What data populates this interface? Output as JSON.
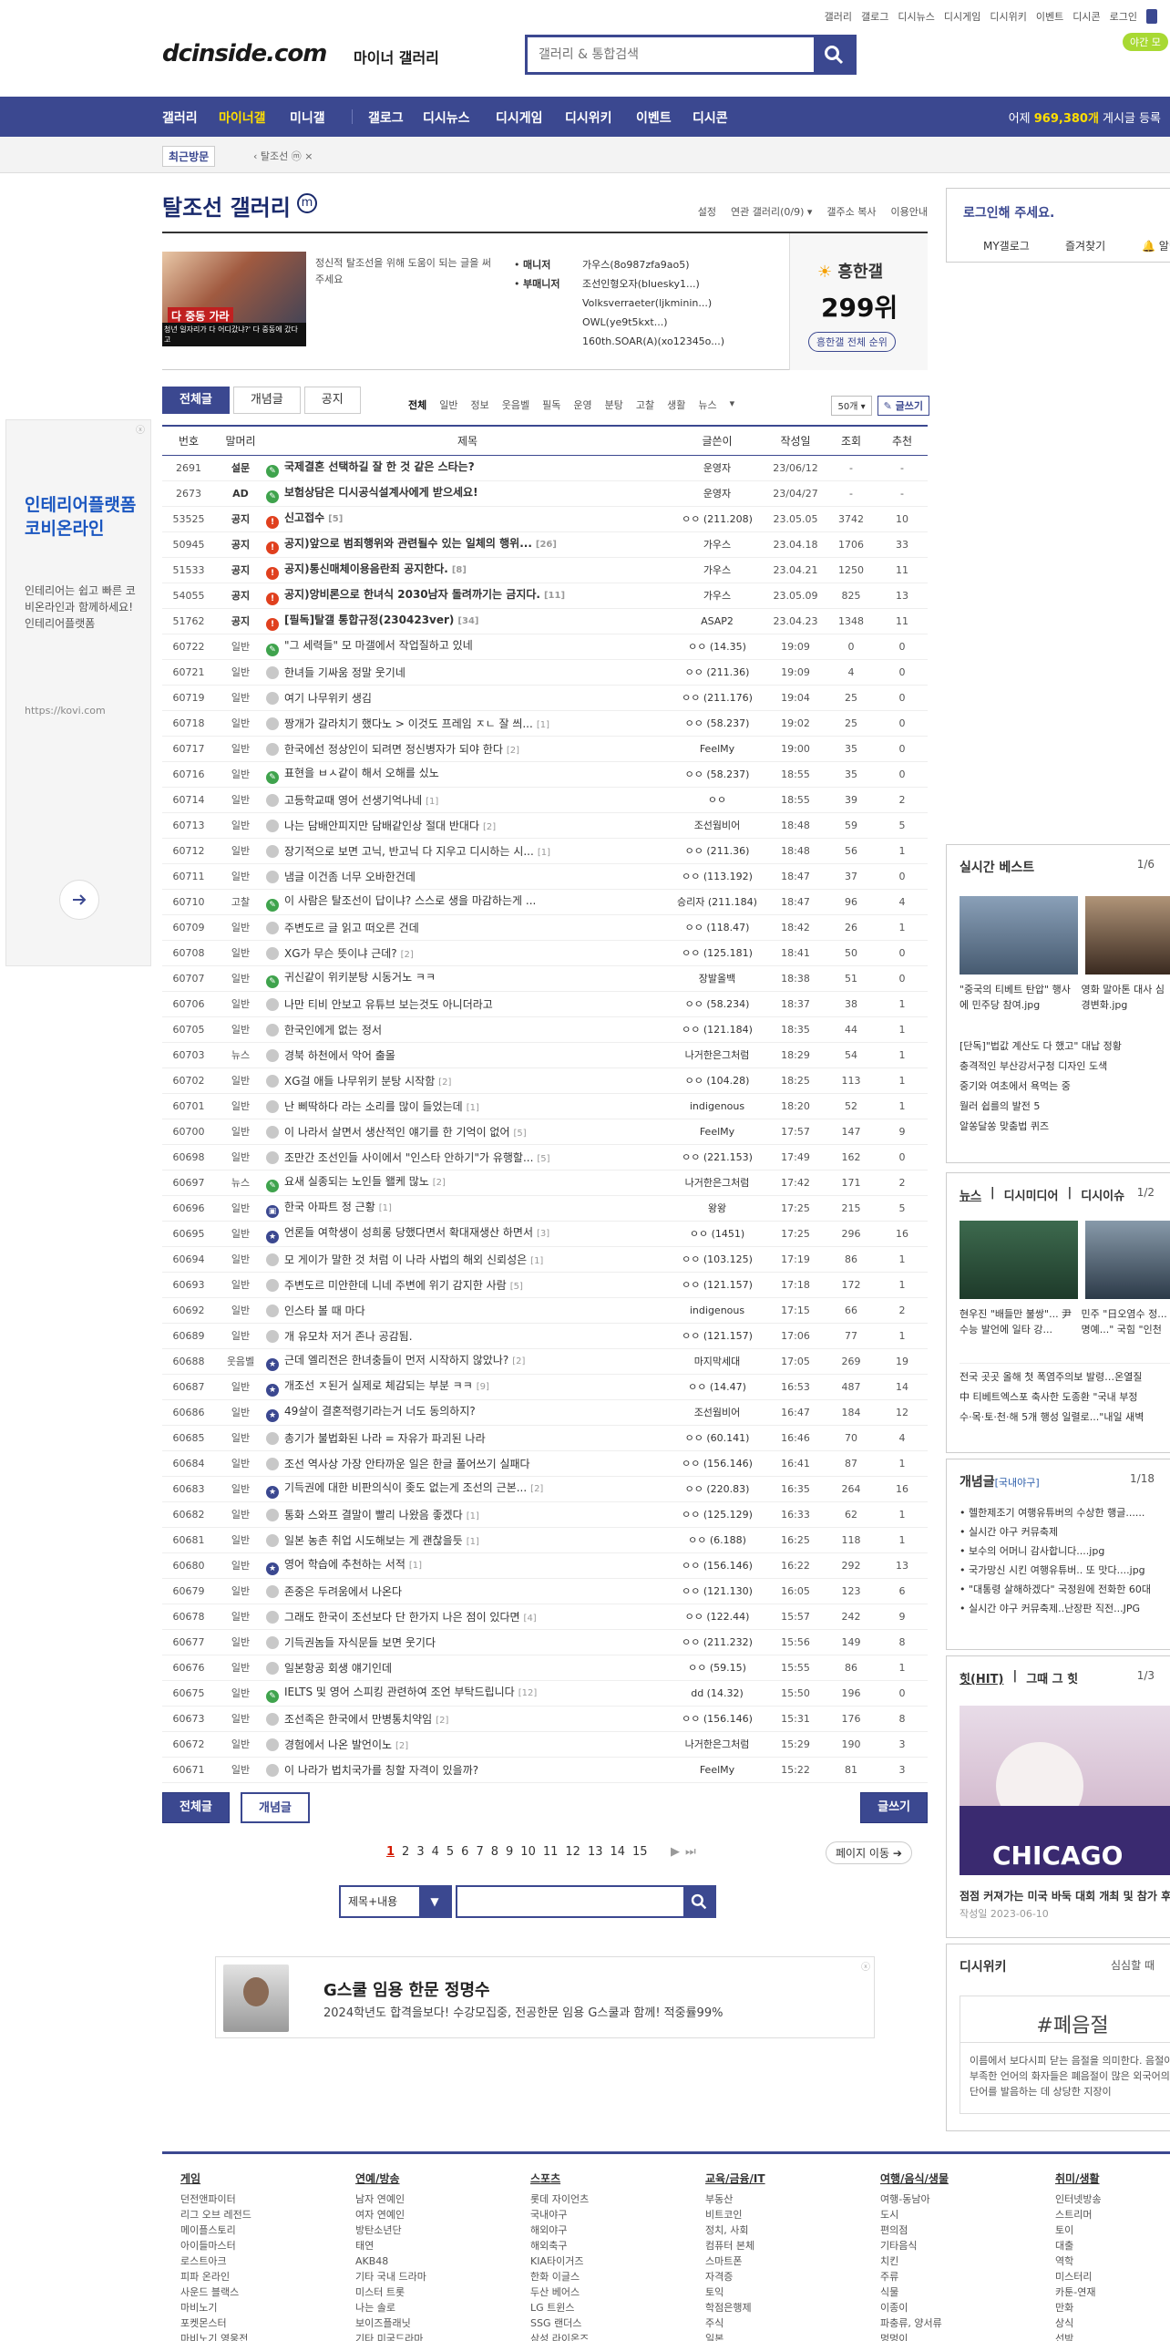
{
  "top_menu": [
    "갤러리",
    "미니갤",
    "갤로그",
    "디시뉴스",
    "디시게임",
    "디시위키",
    "이벤트",
    "디시콘",
    "로그인"
  ],
  "logo": "dcinside.com",
  "logo_sub": "마이너 갤러리",
  "search_placeholder": "갤러리 & 통합검색",
  "app_btn": "야간 모",
  "gnb": {
    "items": [
      "갤러리",
      "마이너갤",
      "미니갤",
      "갤로그",
      "디시뉴스",
      "디시게임",
      "디시위키",
      "이벤트",
      "디시콘"
    ],
    "visit_prefix": "어제 ",
    "visit_count": "969,380개",
    "visit_suffix": " 게시글 등록"
  },
  "subbar": {
    "recent": "최근방문",
    "crumb": "‹ 탈조선 ⓜ  ×"
  },
  "gallery": {
    "title": "탈조선 갤러리",
    "title_badge": "m",
    "links": [
      "설정",
      "연관 갤러리(0/9) ▾",
      "갤주소 복사",
      "이용안내"
    ],
    "desc": "정신적 탈조선을 위해 도움이 되는 글을 써주세요",
    "thumb_cap": "다 중동 가라",
    "thumb_cap2": "청년 일자리가 다 어디갔냐?' 다 중동에 갔다고",
    "manager_label": "매니저",
    "submanager_label": "부매니저",
    "manager": "가우스(8o987zfa9ao5)",
    "submanagers": [
      "조선인형오자(bluesky1...)",
      "Volksverraeter(ljkminin...)",
      "OWL(ye9t5kxt...)",
      "160th.SOAR(A)(xo12345o...)"
    ],
    "rank_title": "흥한갤",
    "rank": "299위",
    "rank_btn": "흥한갤 전체 순위"
  },
  "tabs": [
    "전체글",
    "개념글",
    "공지"
  ],
  "subtabs": [
    "전체",
    "일반",
    "정보",
    "웃음벨",
    "필독",
    "운영",
    "분탕",
    "고찰",
    "생활",
    "뉴스",
    "▾"
  ],
  "list_count": "50개 ▾",
  "write_btn": "✎ 글쓰기",
  "columns": [
    "번호",
    "말머리",
    "제목",
    "글쓴이",
    "작성일",
    "조회",
    "추천"
  ],
  "rows": [
    {
      "no": "2691",
      "head": "설문",
      "title": "국제결혼 선택하길 잘 한 것 같은 스타는?",
      "rep": "",
      "author": "운영자",
      "date": "23/06/12",
      "views": "-",
      "rec": "-",
      "ic": "g",
      "notice": true
    },
    {
      "no": "2673",
      "head": "AD",
      "title": "보험상담은 디시공식설계사에게 받으세요!",
      "rep": "",
      "author": "운영자",
      "date": "23/04/27",
      "views": "-",
      "rec": "-",
      "ic": "g",
      "notice": true
    },
    {
      "no": "53525",
      "head": "공지",
      "title": "신고접수",
      "rep": "[5]",
      "author": "ㅇㅇ (211.208)",
      "date": "23.05.05",
      "views": "3742",
      "rec": "10",
      "ic": "r",
      "notice": true
    },
    {
      "no": "50945",
      "head": "공지",
      "title": "공지)앞으로 범죄행위와 관련될수 있는 일체의 행위...",
      "rep": "[26]",
      "author": "가우스",
      "date": "23.04.18",
      "views": "1706",
      "rec": "33",
      "ic": "r",
      "notice": true
    },
    {
      "no": "51533",
      "head": "공지",
      "title": "공지)통신매체이용음란죄 공지한다.",
      "rep": "[8]",
      "author": "가우스",
      "date": "23.04.21",
      "views": "1250",
      "rec": "11",
      "ic": "r",
      "notice": true
    },
    {
      "no": "54055",
      "head": "공지",
      "title": "공지)앙비론으로 한녀식 2030남자 돌려까기는 금지다.",
      "rep": "[11]",
      "author": "가우스",
      "date": "23.05.09",
      "views": "825",
      "rec": "13",
      "ic": "r",
      "notice": true
    },
    {
      "no": "51762",
      "head": "공지",
      "title": "[필독]탈갤 통합규정(230423ver)",
      "rep": "[34]",
      "author": "ASAP2",
      "date": "23.04.23",
      "views": "1348",
      "rec": "11",
      "ic": "r",
      "notice": true
    },
    {
      "no": "60722",
      "head": "일반",
      "title": "\"그 세력들\" 모 마갤에서 작업질하고 있네",
      "rep": "",
      "author": "ㅇㅇ (14.35)",
      "date": "19:09",
      "views": "0",
      "rec": "0",
      "ic": "g"
    },
    {
      "no": "60721",
      "head": "일반",
      "title": "한녀들 기싸움 정말 웃기네",
      "rep": "",
      "author": "ㅇㅇ (211.36)",
      "date": "19:09",
      "views": "4",
      "rec": "0",
      "ic": "n"
    },
    {
      "no": "60719",
      "head": "일반",
      "title": "여기 나무위키 생김",
      "rep": "",
      "author": "ㅇㅇ (211.176)",
      "date": "19:04",
      "views": "25",
      "rec": "0",
      "ic": "n"
    },
    {
      "no": "60718",
      "head": "일반",
      "title": "짱개가 갈라치기 했다노 > 이것도 프레임 ㅈㄴ 잘 씌...",
      "rep": "[1]",
      "author": "ㅇㅇ (58.237)",
      "date": "19:02",
      "views": "25",
      "rec": "0",
      "ic": "n"
    },
    {
      "no": "60717",
      "head": "일반",
      "title": "한국에선 정상인이 되려면 정신병자가 되야 한다",
      "rep": "[2]",
      "author": "FeelMy",
      "date": "19:00",
      "views": "35",
      "rec": "0",
      "ic": "n"
    },
    {
      "no": "60716",
      "head": "일반",
      "title": "표현을 ㅂㅅ같이 해서 오해를 싰노",
      "rep": "",
      "author": "ㅇㅇ (58.237)",
      "date": "18:55",
      "views": "35",
      "rec": "0",
      "ic": "g"
    },
    {
      "no": "60714",
      "head": "일반",
      "title": "고등학교때 영어 선생기억나네",
      "rep": "[1]",
      "author": "ㅇㅇ",
      "date": "18:55",
      "views": "39",
      "rec": "2",
      "ic": "n"
    },
    {
      "no": "60713",
      "head": "일반",
      "title": "나는 담배안피지만 담배같인상 절대 반대다",
      "rep": "[2]",
      "author": "조선웜비어",
      "date": "18:48",
      "views": "59",
      "rec": "5",
      "ic": "n"
    },
    {
      "no": "60712",
      "head": "일반",
      "title": "장기적으로 보면 고닉, 반고닉 다 지우고 디시하는 시...",
      "rep": "[1]",
      "author": "ㅇㅇ (211.36)",
      "date": "18:48",
      "views": "56",
      "rec": "1",
      "ic": "n"
    },
    {
      "no": "60711",
      "head": "일반",
      "title": "냄글 이건좀 너무 오바한건데",
      "rep": "",
      "author": "ㅇㅇ (113.192)",
      "date": "18:47",
      "views": "37",
      "rec": "0",
      "ic": "n"
    },
    {
      "no": "60710",
      "head": "고찰",
      "title": "이 사람은 탈조선이 답이냐? 스스로 생을 마감하는게 ...",
      "rep": "",
      "author": "승리자 (211.184)",
      "date": "18:47",
      "views": "96",
      "rec": "4",
      "ic": "g"
    },
    {
      "no": "60709",
      "head": "일반",
      "title": "주변도르 글 읽고 떠오른 건데",
      "rep": "",
      "author": "ㅇㅇ (118.47)",
      "date": "18:42",
      "views": "26",
      "rec": "1",
      "ic": "n"
    },
    {
      "no": "60708",
      "head": "일반",
      "title": "XG가 무슨 뜻이냐 근데?",
      "rep": "[2]",
      "author": "ㅇㅇ (125.181)",
      "date": "18:41",
      "views": "50",
      "rec": "0",
      "ic": "n"
    },
    {
      "no": "60707",
      "head": "일반",
      "title": "귀신같이 위키분탕 시동거노 ㅋㅋ",
      "rep": "",
      "author": "장발올백",
      "date": "18:38",
      "views": "51",
      "rec": "0",
      "ic": "g"
    },
    {
      "no": "60706",
      "head": "일반",
      "title": "나만 티비 안보고 유튜브 보는것도 아니더라고",
      "rep": "",
      "author": "ㅇㅇ (58.234)",
      "date": "18:37",
      "views": "38",
      "rec": "1",
      "ic": "n"
    },
    {
      "no": "60705",
      "head": "일반",
      "title": "한국인에게 없는 정서",
      "rep": "",
      "author": "ㅇㅇ (121.184)",
      "date": "18:35",
      "views": "44",
      "rec": "1",
      "ic": "n"
    },
    {
      "no": "60703",
      "head": "뉴스",
      "title": "경북 하천에서 악어 출몰",
      "rep": "",
      "author": "나거한은그처럼",
      "date": "18:29",
      "views": "54",
      "rec": "1",
      "ic": "n"
    },
    {
      "no": "60702",
      "head": "일반",
      "title": "XG걸 애들 나무위키 분탕 시작함",
      "rep": "[2]",
      "author": "ㅇㅇ (104.28)",
      "date": "18:25",
      "views": "113",
      "rec": "1",
      "ic": "n"
    },
    {
      "no": "60701",
      "head": "일반",
      "title": "난 삐딱하다 라는 소리를 많이 들었는데",
      "rep": "[1]",
      "author": "indigenous",
      "date": "18:20",
      "views": "52",
      "rec": "1",
      "ic": "n"
    },
    {
      "no": "60700",
      "head": "일반",
      "title": "이 나라서 살면서 생산적인 얘기를 한 기억이 없어",
      "rep": "[5]",
      "author": "FeelMy",
      "date": "17:57",
      "views": "147",
      "rec": "9",
      "ic": "n"
    },
    {
      "no": "60698",
      "head": "일반",
      "title": "조만간 조선인들 사이에서 \"인스타 안하기\"가 유행할...",
      "rep": "[5]",
      "author": "ㅇㅇ (221.153)",
      "date": "17:49",
      "views": "162",
      "rec": "0",
      "ic": "n"
    },
    {
      "no": "60697",
      "head": "뉴스",
      "title": "요새 실종되는 노인들 왤케 많노",
      "rep": "[2]",
      "author": "나거한은그처럼",
      "date": "17:42",
      "views": "171",
      "rec": "2",
      "ic": "g"
    },
    {
      "no": "60696",
      "head": "일반",
      "title": "한국 아파트 정 근황",
      "rep": "[1]",
      "author": "왕왕",
      "date": "17:25",
      "views": "215",
      "rec": "5",
      "ic": "b"
    },
    {
      "no": "60695",
      "head": "일반",
      "title": "언론들 여학생이 성희롱 당했다면서 확대재생산 하면서",
      "rep": "[3]",
      "author": "ㅇㅇ (1451)",
      "date": "17:25",
      "views": "296",
      "rec": "16",
      "ic": "s"
    },
    {
      "no": "60694",
      "head": "일반",
      "title": "모 게이가 말한 것 처럼 이 나라 사법의 해외 신뢰성은",
      "rep": "[1]",
      "author": "ㅇㅇ (103.125)",
      "date": "17:19",
      "views": "86",
      "rec": "1",
      "ic": "n"
    },
    {
      "no": "60693",
      "head": "일반",
      "title": "주변도르 미안한데 니네 주변에 위기 감지한 사람",
      "rep": "[5]",
      "author": "ㅇㅇ (121.157)",
      "date": "17:18",
      "views": "172",
      "rec": "1",
      "ic": "n"
    },
    {
      "no": "60692",
      "head": "일반",
      "title": "인스타 볼 때 마다",
      "rep": "",
      "author": "indigenous",
      "date": "17:15",
      "views": "66",
      "rec": "2",
      "ic": "n"
    },
    {
      "no": "60689",
      "head": "일반",
      "title": "개 유모차 저거 존나 공감됨.",
      "rep": "",
      "author": "ㅇㅇ (121.157)",
      "date": "17:06",
      "views": "77",
      "rec": "1",
      "ic": "n"
    },
    {
      "no": "60688",
      "head": "웃음벨",
      "title": "근데 엘리전은 한녀충들이 먼저 시작하지 않았나?",
      "rep": "[2]",
      "author": "마지막세대",
      "date": "17:05",
      "views": "269",
      "rec": "19",
      "ic": "s"
    },
    {
      "no": "60687",
      "head": "일반",
      "title": "개조선 ㅈ된거 실제로 체감되는 부분 ㅋㅋ",
      "rep": "[9]",
      "author": "ㅇㅇ (14.47)",
      "date": "16:53",
      "views": "487",
      "rec": "14",
      "ic": "s"
    },
    {
      "no": "60686",
      "head": "일반",
      "title": "49살이 결혼적령기라는거 너도 동의하지?",
      "rep": "",
      "author": "조선웜비어",
      "date": "16:47",
      "views": "184",
      "rec": "12",
      "ic": "s"
    },
    {
      "no": "60685",
      "head": "일반",
      "title": "총기가 불법화된 나라 = 자유가 파괴된 나라",
      "rep": "",
      "author": "ㅇㅇ (60.141)",
      "date": "16:46",
      "views": "70",
      "rec": "4",
      "ic": "n"
    },
    {
      "no": "60684",
      "head": "일반",
      "title": "조선 역사상 가장 안타까운 일은 한글 풀어쓰기 실패다",
      "rep": "",
      "author": "ㅇㅇ (156.146)",
      "date": "16:41",
      "views": "87",
      "rec": "1",
      "ic": "n"
    },
    {
      "no": "60683",
      "head": "일반",
      "title": "기득권에 대한 비판의식이 좆도 없는게 조선의 근본...",
      "rep": "[2]",
      "author": "ㅇㅇ (220.83)",
      "date": "16:35",
      "views": "264",
      "rec": "16",
      "ic": "s"
    },
    {
      "no": "60682",
      "head": "일반",
      "title": "통화 스와프 결말이 빨리 나왔음 좋겠다",
      "rep": "[1]",
      "author": "ㅇㅇ (125.129)",
      "date": "16:33",
      "views": "62",
      "rec": "1",
      "ic": "n"
    },
    {
      "no": "60681",
      "head": "일반",
      "title": "일본 농촌 취업 시도해보는 게 괜찮을듯",
      "rep": "[1]",
      "author": "ㅇㅇ (6.188)",
      "date": "16:25",
      "views": "118",
      "rec": "1",
      "ic": "n"
    },
    {
      "no": "60680",
      "head": "일반",
      "title": "영어 학습에 추천하는 서적",
      "rep": "[1]",
      "author": "ㅇㅇ (156.146)",
      "date": "16:22",
      "views": "292",
      "rec": "13",
      "ic": "s"
    },
    {
      "no": "60679",
      "head": "일반",
      "title": "존중은 두려움에서 나온다",
      "rep": "",
      "author": "ㅇㅇ (121.130)",
      "date": "16:05",
      "views": "123",
      "rec": "6",
      "ic": "n"
    },
    {
      "no": "60678",
      "head": "일반",
      "title": "그래도 한국이 조선보다 단 한가지 나은 점이 있다면",
      "rep": "[4]",
      "author": "ㅇㅇ (122.44)",
      "date": "15:57",
      "views": "242",
      "rec": "9",
      "ic": "n"
    },
    {
      "no": "60677",
      "head": "일반",
      "title": "기득권놈들 자식문들 보면 웃기다",
      "rep": "",
      "author": "ㅇㅇ (211.232)",
      "date": "15:56",
      "views": "149",
      "rec": "8",
      "ic": "n"
    },
    {
      "no": "60676",
      "head": "일반",
      "title": "일본항공 회생 얘기인데",
      "rep": "",
      "author": "ㅇㅇ (59.15)",
      "date": "15:55",
      "views": "86",
      "rec": "1",
      "ic": "n"
    },
    {
      "no": "60675",
      "head": "일반",
      "title": "IELTS 및 영어 스피킹 관련하여 조언 부탁드립니다",
      "rep": "[12]",
      "author": "dd (14.32)",
      "date": "15:50",
      "views": "196",
      "rec": "0",
      "ic": "g"
    },
    {
      "no": "60673",
      "head": "일반",
      "title": "조선족은 한국에서 만병통치약임",
      "rep": "[2]",
      "author": "ㅇㅇ (156.146)",
      "date": "15:31",
      "views": "176",
      "rec": "8",
      "ic": "n"
    },
    {
      "no": "60672",
      "head": "일반",
      "title": "경험에서 나온 발언이노",
      "rep": "[2]",
      "author": "나거한은그처럼",
      "date": "15:29",
      "views": "190",
      "rec": "3",
      "ic": "n"
    },
    {
      "no": "60671",
      "head": "일반",
      "title": "이 나라가 법치국가를 칭할 자격이 있을까?",
      "rep": "",
      "author": "FeelMy",
      "date": "15:22",
      "views": "81",
      "rec": "3",
      "ic": "n"
    }
  ],
  "bottom": {
    "all_btn": "전체글",
    "concept_btn": "개념글",
    "write_btn": "글쓰기"
  },
  "pages": [
    "1",
    "2",
    "3",
    "4",
    "5",
    "6",
    "7",
    "8",
    "9",
    "10",
    "11",
    "12",
    "13",
    "14",
    "15"
  ],
  "page_move": "페이지 이동 ➔",
  "search_select": "제목+내용",
  "ad_bottom": {
    "title": "G스쿨 임용 한문 정명수",
    "desc": "2024학년도 합격을보다! 수강모집중, 전공한문 임용 G스쿨과 함께! 적중률99%"
  },
  "left_ad": {
    "title": "인테리어플랫폼 코비온라인",
    "desc": "인테리어는 쉽고 빠른 코비온라인과 함께하세요!인테리어플랫폼",
    "url": "https://kovi.com"
  },
  "login_box": {
    "title": "로그인해 주세요.",
    "links": [
      "MY갤로그",
      "즐겨찾기",
      "🔔 알림"
    ]
  },
  "realtime": {
    "title": "실시간 베스트",
    "page": "1/6",
    "caps": [
      "\"중국의 티베트 탄압\" 행사에 민주당 참여.jpg",
      "영화 말아톤 대사 심경변화.jpg"
    ],
    "lines": [
      "[단독]\"법값 계산도 다 했고\" 대납 정황",
      "충격적인 부산강서구청 디자인 도색",
      "중기와 여초에서 욕먹는 중",
      "월러 쉽를의 발전 5",
      "알쏭달쏭 맞춤법 퀴즈"
    ]
  },
  "news": {
    "tabs": [
      "뉴스",
      "디시미디어",
      "디시이슈"
    ],
    "page": "1/2",
    "caps": [
      "현우진 \"배들만 불쌍\"... 尹 수능 발언에 일타 강...",
      "민주 \"日오염수 정... 명예...\" 국힘 \"인천"
    ],
    "lines": [
      "전국 곳곳 올해 첫 폭염주의보 발령…온열질",
      "中 티베트엑스포 축사한 도종환 \"국내 부정",
      "수·목·토·천·해 5개 행성 일렬로...\"내일 새벽"
    ]
  },
  "concept": {
    "title": "개념글",
    "sub": "[국내야구]",
    "page": "1/18",
    "lines": [
      "헬한제조기 여행유튜버의 수상한 행글......",
      "실시간 야구 커뮤축제",
      "보수의 어머니 감사합니다....jpg",
      "국가망신 시킨 여행유튜버.. 또 맛다....jpg",
      "\"대통령 살해하겠다\" 국정원에 전화한 60대",
      "실시간 야구 커뮤축제..난장판 직전...JPG"
    ]
  },
  "hit": {
    "title": "힛(HIT)",
    "title2": "그때 그 힛",
    "page": "1/3",
    "banner": "CHICAGO",
    "caption": "점점 커져가는 미국 바둑 대회 개최 및 참가 후기",
    "date": "작성일 2023-06-10"
  },
  "wiki": {
    "title": "디시위키",
    "sub": "심심할 때",
    "word": "#폐음절",
    "desc": "이름에서 보다시피 닫는 음절을 의미한다. 음절이 부족한 언어의 화자들은 폐음절이 많은 외국어의 단어를 발음하는 데 상당한 지장이"
  },
  "footer": [
    {
      "h": "게임",
      "items": [
        "던전앤파이터",
        "리그 오브 레전드",
        "메이플스토리",
        "아이들마스터",
        "로스트아크",
        "피파 온라인",
        "사운드 블랙스",
        "마비노기",
        "포켓몬스터",
        "마비노기 영웅전"
      ]
    },
    {
      "h": "연예/방송",
      "items": [
        "남자 연예인",
        "여자 연예인",
        "방탄소년단",
        "태연",
        "AKB48",
        "기타 국내 드라마",
        "미스터 트롯",
        "나는 솔로",
        "보이즈플래닛",
        "기타 미국드라마"
      ]
    },
    {
      "h": "스포츠",
      "items": [
        "롯데 자이언츠",
        "국내야구",
        "해외야구",
        "해외축구",
        "KIA타이거즈",
        "한화 이글스",
        "두산 베어스",
        "LG 트윈스",
        "SSG 랜더스",
        "삼성 라이온즈"
      ]
    },
    {
      "h": "교육/금융/IT",
      "items": [
        "부동산",
        "비트코인",
        "정치, 사회",
        "컴퓨터 본체",
        "스마트폰",
        "자격증",
        "토익",
        "학점은행제",
        "주식",
        "일본"
      ]
    },
    {
      "h": "여행/음식/생물",
      "items": [
        "여행-동남아",
        "도시",
        "편의점",
        "기타음식",
        "치킨",
        "주류",
        "식물",
        "이종이",
        "파충류, 양서류",
        "멍멍이"
      ]
    },
    {
      "h": "취미/생활",
      "items": [
        "인터넷방송",
        "스트리머",
        "토이",
        "대출",
        "역학",
        "미스터리",
        "카툰-연재",
        "만화",
        "상식",
        "선박"
      ]
    }
  ]
}
